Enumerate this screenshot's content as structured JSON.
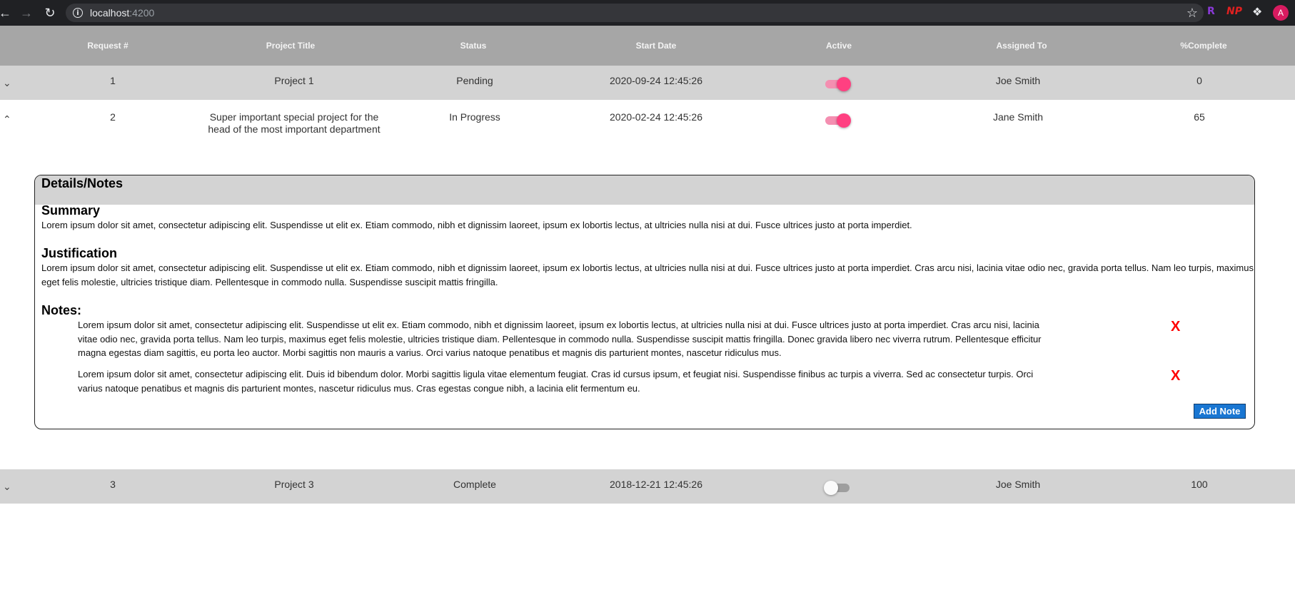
{
  "browser": {
    "url_host": "localhost",
    "url_port": ":4200",
    "back_icon": "arrow-left-icon",
    "forward_icon": "arrow-right-icon",
    "reload_icon": "reload-icon",
    "extensions": [
      "R",
      "NP"
    ],
    "avatar_letter": "A"
  },
  "table": {
    "headers": [
      "Request #",
      "Project Title",
      "Status",
      "Start Date",
      "Active",
      "Assigned To",
      "%Complete"
    ],
    "rows": [
      {
        "request": "1",
        "title": "Project 1",
        "status": "Pending",
        "start_date": "2020-09-24 12:45:26",
        "active": true,
        "assigned_to": "Joe Smith",
        "complete": "0",
        "expanded": false
      },
      {
        "request": "2",
        "title": "Super important special project for the head of the most important department",
        "status": "In Progress",
        "start_date": "2020-02-24 12:45:26",
        "active": true,
        "assigned_to": "Jane Smith",
        "complete": "65",
        "expanded": true
      },
      {
        "request": "3",
        "title": "Project 3",
        "status": "Complete",
        "start_date": "2018-12-21 12:45:26",
        "active": false,
        "assigned_to": "Joe Smith",
        "complete": "100",
        "expanded": false
      }
    ]
  },
  "details": {
    "heading": "Details/Notes",
    "summary_label": "Summary",
    "summary_text": "Lorem ipsum dolor sit amet, consectetur adipiscing elit. Suspendisse ut elit ex. Etiam commodo, nibh et dignissim laoreet, ipsum ex lobortis lectus, at ultricies nulla nisi at dui. Fusce ultrices justo at porta imperdiet.",
    "justification_label": "Justification",
    "justification_text": "Lorem ipsum dolor sit amet, consectetur adipiscing elit. Suspendisse ut elit ex. Etiam commodo, nibh et dignissim laoreet, ipsum ex lobortis lectus, at ultricies nulla nisi at dui. Fusce ultrices justo at porta imperdiet. Cras arcu nisi, lacinia vitae odio nec, gravida porta tellus. Nam leo turpis, maximus eget felis molestie, ultricies tristique diam. Pellentesque in commodo nulla. Suspendisse suscipit mattis fringilla.",
    "notes_label": "Notes:",
    "notes": [
      "Lorem ipsum dolor sit amet, consectetur adipiscing elit. Suspendisse ut elit ex. Etiam commodo, nibh et dignissim laoreet, ipsum ex lobortis lectus, at ultricies nulla nisi at dui. Fusce ultrices justo at porta imperdiet. Cras arcu nisi, lacinia vitae odio nec, gravida porta tellus. Nam leo turpis, maximus eget felis molestie, ultricies tristique diam. Pellentesque in commodo nulla. Suspendisse suscipit mattis fringilla. Donec gravida libero nec viverra rutrum. Pellentesque efficitur magna egestas diam sagittis, eu porta leo auctor. Morbi sagittis non mauris a varius. Orci varius natoque penatibus et magnis dis parturient montes, nascetur ridiculus mus.",
      "Lorem ipsum dolor sit amet, consectetur adipiscing elit. Duis id bibendum dolor. Morbi sagittis ligula vitae elementum feugiat. Cras id cursus ipsum, et feugiat nisi. Suspendisse finibus ac turpis a viverra. Sed ac consectetur turpis. Orci varius natoque penatibus et magnis dis parturient montes, nascetur ridiculus mus. Cras egestas congue nibh, a lacinia elit fermentum eu."
    ],
    "delete_label": "X",
    "add_note_label": "Add Note"
  },
  "colors": {
    "toggle_on": "#ff4081",
    "header_bg": "#a6a6a6",
    "row_bg": "#d3d3d3",
    "add_button": "#1976d2",
    "delete_x": "#ff0000"
  }
}
